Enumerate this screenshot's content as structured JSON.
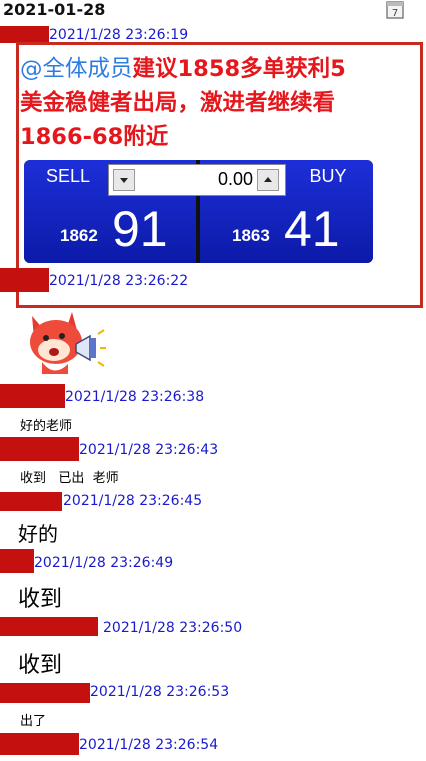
{
  "header": {
    "date": "2021-01-28"
  },
  "notice": {
    "mention": "@全体成员",
    "line1": "建议1858多单获利5",
    "line2": "美金稳健者出局，激进者继续看",
    "line3": "1866-68附近"
  },
  "trade": {
    "sell_label": "SELL",
    "buy_label": "BUY",
    "quantity": "0.00",
    "sell_price_prefix": "1862",
    "sell_price_main": "91",
    "buy_price_prefix": "1863",
    "buy_price_main": "41"
  },
  "messages": [
    {
      "time": "2021/1/28 23:26:19"
    },
    {
      "time": "2021/1/28 23:26:22"
    },
    {
      "time": "2021/1/28 23:26:38",
      "text": "好的老师"
    },
    {
      "time": "2021/1/28 23:26:43",
      "text": "收到   已出  老师"
    },
    {
      "time": "2021/1/28 23:26:45",
      "text": "好的"
    },
    {
      "time": "2021/1/28 23:26:49",
      "text": "收到"
    },
    {
      "time": "2021/1/28 23:26:50",
      "text": "收到"
    },
    {
      "time": "2021/1/28 23:26:53",
      "text": "出了"
    },
    {
      "time": "2021/1/28 23:26:54"
    }
  ],
  "icons": {
    "calendar": "calendar-icon",
    "sticker": "fox-megaphone-sticker"
  }
}
